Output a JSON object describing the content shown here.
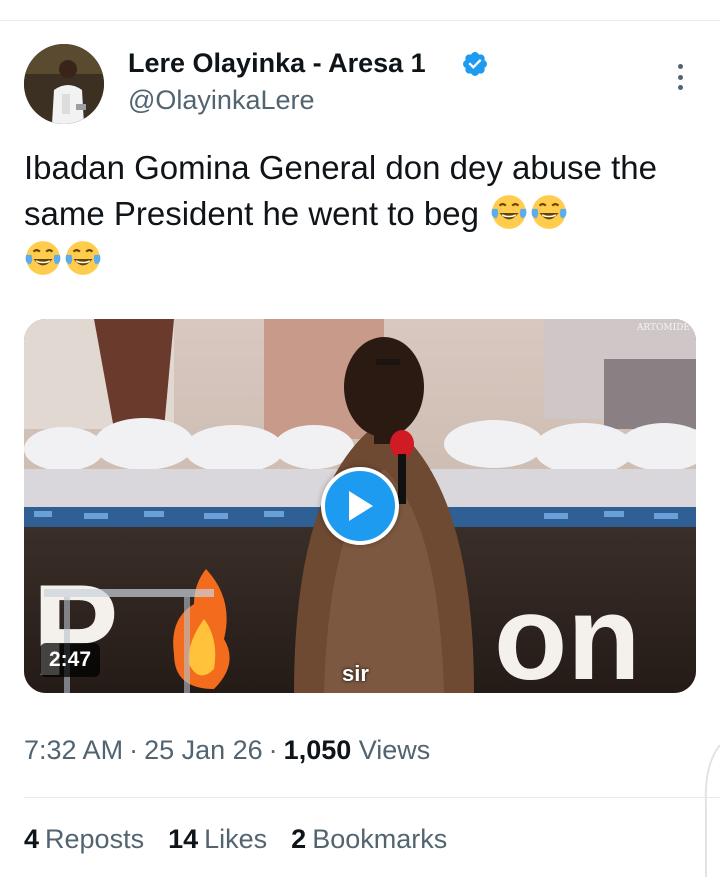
{
  "author": {
    "display_name": "Lere Olayinka - Aresa 1",
    "handle": "@OlayinkaLere",
    "verified": true
  },
  "tweet": {
    "text": "Ibadan Gomina General don dey abuse the same President he went to beg",
    "emojis": [
      "face-with-tears-of-joy",
      "face-with-tears-of-joy",
      "face-with-tears-of-joy",
      "face-with-tears-of-joy"
    ]
  },
  "media": {
    "type": "video",
    "duration": "2:47",
    "caption": "sir"
  },
  "meta": {
    "time": "7:32 AM",
    "date": "25 Jan 26",
    "views_count": "1,050",
    "views_label": "Views"
  },
  "stats": {
    "reposts_count": "4",
    "reposts_label": "Reposts",
    "likes_count": "14",
    "likes_label": "Likes",
    "bookmarks_count": "2",
    "bookmarks_label": "Bookmarks"
  },
  "colors": {
    "accent": "#1d9bf0",
    "text_primary": "#0f1419",
    "text_secondary": "#536471",
    "divider": "#e7e9ea"
  }
}
